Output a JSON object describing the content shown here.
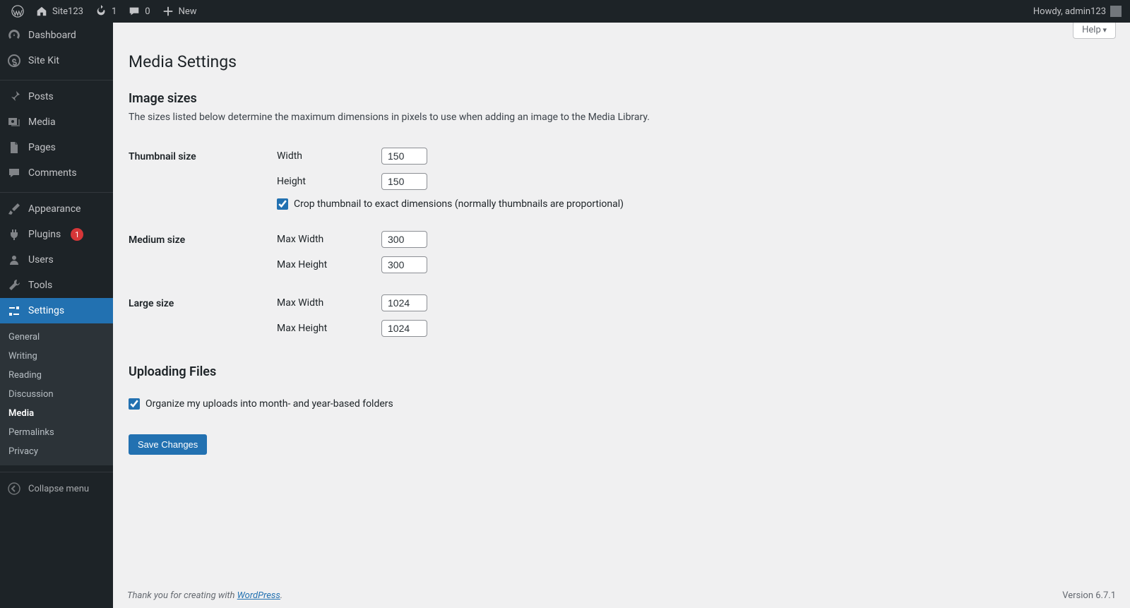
{
  "toolbar": {
    "site_name": "Site123",
    "updates": "1",
    "comments": "0",
    "new_label": "New",
    "greeting": "Howdy, admin123"
  },
  "sidebar": {
    "items": [
      {
        "label": "Dashboard"
      },
      {
        "label": "Site Kit"
      },
      {
        "label": "Posts"
      },
      {
        "label": "Media"
      },
      {
        "label": "Pages"
      },
      {
        "label": "Comments"
      },
      {
        "label": "Appearance"
      },
      {
        "label": "Plugins"
      },
      {
        "label": "Users"
      },
      {
        "label": "Tools"
      },
      {
        "label": "Settings"
      }
    ],
    "plugins_badge": "1",
    "submenu": [
      {
        "label": "General"
      },
      {
        "label": "Writing"
      },
      {
        "label": "Reading"
      },
      {
        "label": "Discussion"
      },
      {
        "label": "Media"
      },
      {
        "label": "Permalinks"
      },
      {
        "label": "Privacy"
      }
    ],
    "collapse": "Collapse menu"
  },
  "help_tab": "Help",
  "page_title": "Media Settings",
  "section_image_sizes": "Image sizes",
  "image_sizes_desc": "The sizes listed below determine the maximum dimensions in pixels to use when adding an image to the Media Library.",
  "thumb": {
    "heading": "Thumbnail size",
    "width_label": "Width",
    "width_value": "150",
    "height_label": "Height",
    "height_value": "150",
    "crop_label": "Crop thumbnail to exact dimensions (normally thumbnails are proportional)"
  },
  "medium": {
    "heading": "Medium size",
    "w_label": "Max Width",
    "w_value": "300",
    "h_label": "Max Height",
    "h_value": "300"
  },
  "large": {
    "heading": "Large size",
    "w_label": "Max Width",
    "w_value": "1024",
    "h_label": "Max Height",
    "h_value": "1024"
  },
  "section_upload": "Uploading Files",
  "organize_label": "Organize my uploads into month- and year-based folders",
  "save_button": "Save Changes",
  "footer": {
    "thanks_prefix": "Thank you for creating with ",
    "wp_link": "WordPress",
    "version": "Version 6.7.1"
  }
}
